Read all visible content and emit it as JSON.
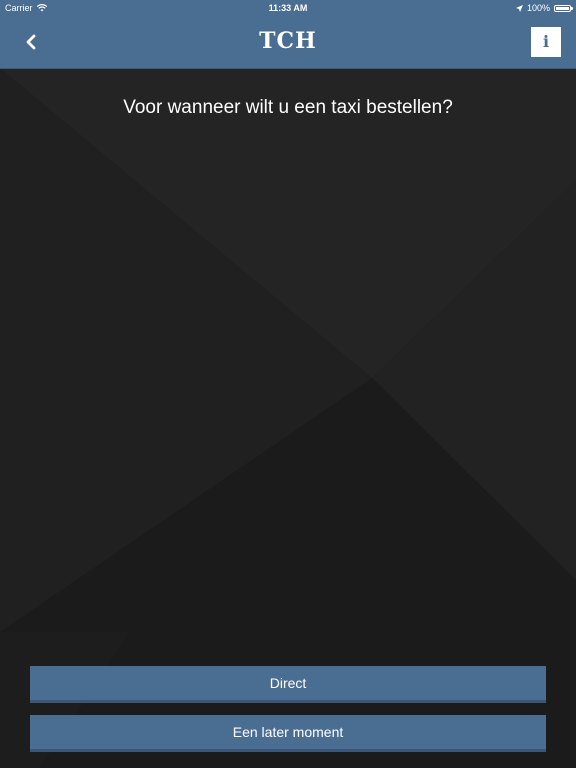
{
  "status_bar": {
    "carrier": "Carrier",
    "time": "11:33 AM",
    "battery": "100%",
    "battery_level": 1.0
  },
  "nav": {
    "title": "TCH",
    "back_icon": "chevron-left-icon",
    "info_label": "i"
  },
  "question": "Voor wanneer wilt u een taxi bestellen?",
  "buttons": {
    "direct": "Direct",
    "later": "Een later moment"
  },
  "colors": {
    "primary": "#4a6d92",
    "background": "#1e1e1e",
    "text": "#ffffff"
  }
}
